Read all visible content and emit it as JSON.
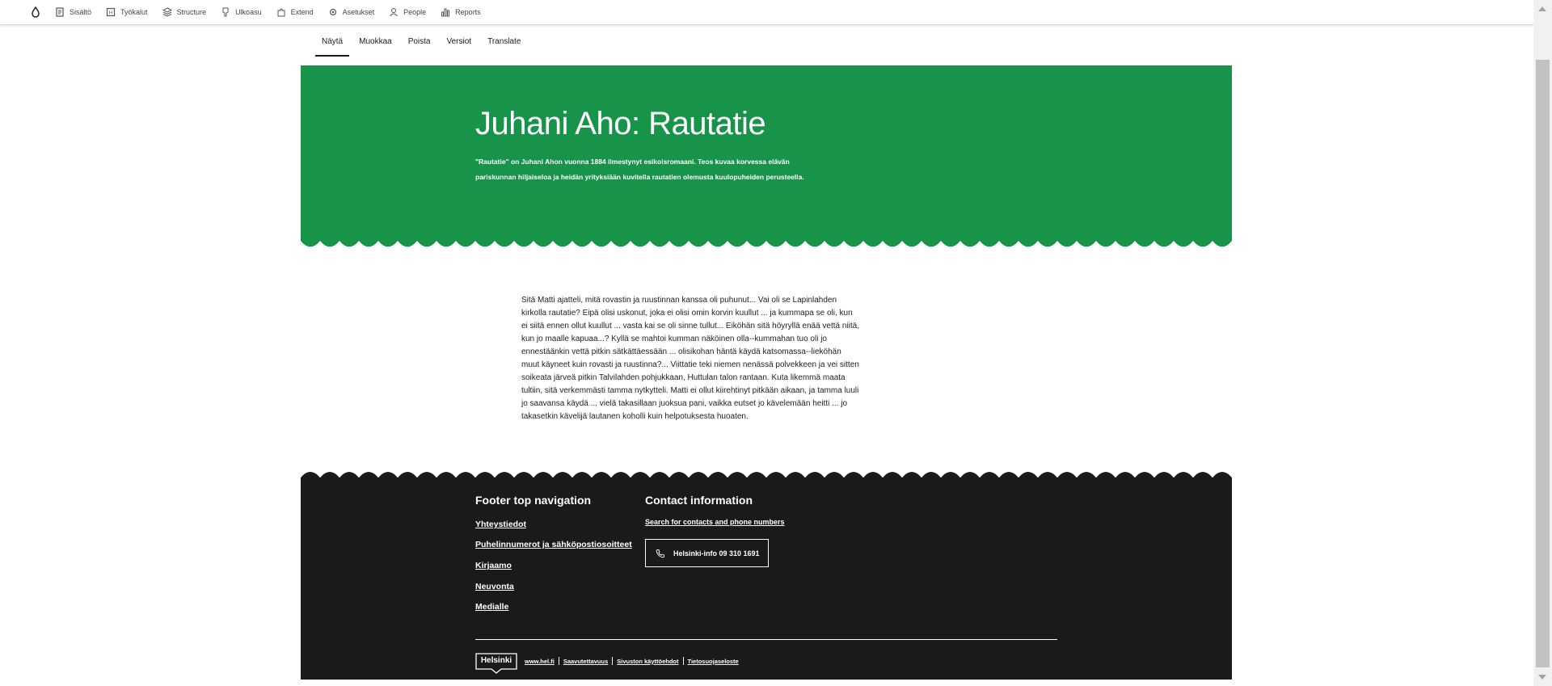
{
  "toolbar": {
    "items": [
      {
        "label": "Sisältö",
        "icon": "document-icon"
      },
      {
        "label": "Työkalut",
        "icon": "tools-icon"
      },
      {
        "label": "Structure",
        "icon": "structure-icon"
      },
      {
        "label": "Ulkoasu",
        "icon": "brush-icon"
      },
      {
        "label": "Extend",
        "icon": "puzzle-icon"
      },
      {
        "label": "Asetukset",
        "icon": "gear-icon"
      },
      {
        "label": "People",
        "icon": "person-icon"
      },
      {
        "label": "Reports",
        "icon": "chart-icon"
      }
    ]
  },
  "tabs": [
    "Näytä",
    "Muokkaa",
    "Poista",
    "Versiot",
    "Translate"
  ],
  "hero": {
    "title": "Juhani Aho: Rautatie",
    "lead": "\"Rautatie\" on Juhani Ahon vuonna 1884 ilmestynyt esikoisromaani. Teos kuvaa korvessa elävän pariskunnan hiljaiseloa ja heidän yrityksiään kuvitella rautatien olemusta kuulopuheiden perusteella.",
    "color": "#17944a"
  },
  "body": {
    "text": "Sitä Matti ajatteli, mitä rovastin ja ruustinnan kanssa oli puhunut... Vai oli se Lapinlahden kirkolla rautatie? Eipä olisi uskonut, joka ei olisi omin korvin kuullut ... ja kummapa se oli, kun ei siitä ennen ollut kuullut ... vasta kai se oli sinne tullut... Eiköhän sitä höyryllä enää vettä niitä, kun jo maalle kapuaa...? Kyllä se mahtoi kumman näköinen olla--kummahan tuo oli jo ennestäänkin vettä pitkin sätkättäessään ... olisikohan häntä käydä katsomassa--lieköhän muut käyneet kuin rovasti ja ruustinna?... Viittatie teki niemen nenässä polvekkeen ja vei sitten soikeata järveä pitkin Talvilahden pohjukkaan, Huttulan talon rantaan. Kuta likemmä maata tultiin, sitä verkemmästi tamma nytkytteli. Matti ei ollut kiirehtinyt pitkään aikaan, ja tamma luuli jo saavansa käydä ... vielä takasillaan juoksua pani, vaikka eutset jo kävelemään heitti ... jo takasetkin kävelijä lautanen koholli kuin helpotuksesta huoaten."
  },
  "footer": {
    "nav_title": "Footer top navigation",
    "nav_links": [
      "Yhteystiedot",
      "Puhelinnumerot ja sähköpostiosoitteet",
      "Kirjaamo",
      "Neuvonta",
      "Medialle"
    ],
    "contact_title": "Contact information",
    "contact_link": "Search for contacts and phone numbers",
    "phone_label": "Helsinki-info 09 310 1691",
    "logo_text": "Helsinki",
    "bottom_links": [
      "www.hel.fi",
      "Saavutettavuus",
      "Sivuston käyttöehdot",
      "Tietosuojaseloste"
    ]
  }
}
